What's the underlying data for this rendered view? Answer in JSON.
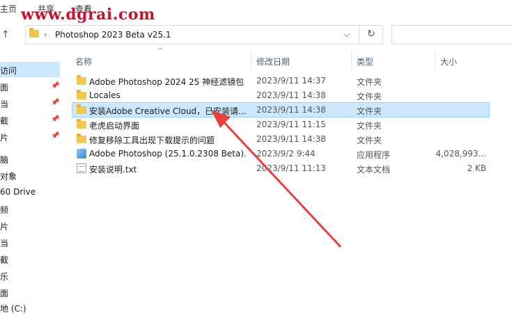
{
  "ribbon": {
    "tabs": [
      "主页",
      "共享",
      "查看"
    ]
  },
  "watermark": "www.dgrai.com",
  "address": {
    "path": "Photoshop 2023 Beta v25.1",
    "separator": "›",
    "dropdown": "⌵",
    "refresh": "↻"
  },
  "sidebar": {
    "items": [
      {
        "label": "访问",
        "selected": true,
        "pinned": false
      },
      {
        "label": "面",
        "pinned": true
      },
      {
        "label": "当",
        "pinned": true
      },
      {
        "label": "截",
        "pinned": true
      },
      {
        "label": "片",
        "pinned": true
      },
      {
        "label": "脑"
      },
      {
        "label": " 对象"
      },
      {
        "label": "60 Drive"
      },
      {
        "label": "频"
      },
      {
        "label": "片"
      },
      {
        "label": "当"
      },
      {
        "label": "截"
      },
      {
        "label": "乐"
      },
      {
        "label": "面"
      },
      {
        "label": "地 (C:)"
      }
    ],
    "pin_glyph": "📌"
  },
  "columns": {
    "name": "名称",
    "date": "修改日期",
    "type": "类型",
    "size": "大小"
  },
  "files": [
    {
      "name": "Adobe Photoshop 2024 25 神经滤镜包",
      "date": "2023/9/11 14:37",
      "type": "文件夹",
      "size": "",
      "icon": "folder-icon",
      "selected": false
    },
    {
      "name": "Locales",
      "date": "2023/9/11 14:38",
      "type": "文件夹",
      "size": "",
      "icon": "folder-icon",
      "selected": false
    },
    {
      "name": "安装Adobe Creative Cloud，已安装请...",
      "date": "2023/9/11 14:38",
      "type": "文件夹",
      "size": "",
      "icon": "folder-icon",
      "selected": true
    },
    {
      "name": "老虎启动界面",
      "date": "2023/9/11 11:15",
      "type": "文件夹",
      "size": "",
      "icon": "folder-icon",
      "selected": false
    },
    {
      "name": "修复移除工具出现下载提示的问题",
      "date": "2023/9/11 14:38",
      "type": "文件夹",
      "size": "",
      "icon": "folder-icon",
      "selected": false
    },
    {
      "name": "Adobe Photoshop (25.1.0.2308 Beta)....",
      "date": "2023/9/2 9:44",
      "type": "应用程序",
      "size": "4,028,993...",
      "icon": "app-icon",
      "selected": false
    },
    {
      "name": "安装说明.txt",
      "date": "2023/9/11 11:13",
      "type": "文本文档",
      "size": "2 KB",
      "icon": "text-file-icon",
      "selected": false
    }
  ],
  "colors": {
    "selection": "#cce8ff",
    "arrow": "#e8403a",
    "watermark": "#c8102e"
  }
}
